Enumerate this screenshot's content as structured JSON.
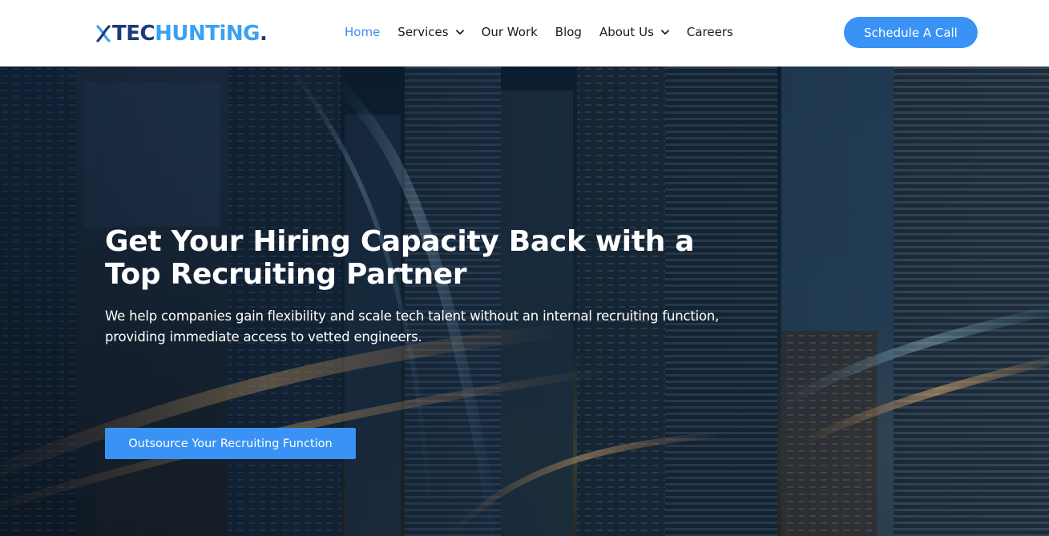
{
  "brand": {
    "name_part1": "TEC",
    "name_part2": "HUNTiNG",
    "name_dot": ".",
    "mark_icon": "x-helix-logo-mark",
    "primary_color": "#1d3a7a",
    "accent_color": "#3aa1f3"
  },
  "nav": {
    "items": [
      {
        "label": "Home",
        "active": true,
        "has_dropdown": false
      },
      {
        "label": "Services",
        "active": false,
        "has_dropdown": true,
        "icon": "chevron-down-icon"
      },
      {
        "label": "Our Work",
        "active": false,
        "has_dropdown": false
      },
      {
        "label": "Blog",
        "active": false,
        "has_dropdown": false
      },
      {
        "label": "About Us",
        "active": false,
        "has_dropdown": true,
        "icon": "chevron-down-icon"
      },
      {
        "label": "Careers",
        "active": false,
        "has_dropdown": false
      }
    ],
    "active_color": "#3a8ff0",
    "text_color": "#1b1b1b"
  },
  "header_cta": {
    "label": "Schedule A Call",
    "color": "#3a93f4"
  },
  "hero": {
    "title_line1": "Get Your Hiring Capacity Back with a",
    "title_line2": "Top Recruiting Partner",
    "subtitle_line1": "We help companies gain flexibility and scale tech talent without an internal recruiting function,",
    "subtitle_line2": "providing immediate access to vetted engineers.",
    "cta_label": "Outsource Your Recruiting Function",
    "cta_color": "#3a93f4",
    "background": "night-city-skyscrapers-with-light-trails"
  }
}
